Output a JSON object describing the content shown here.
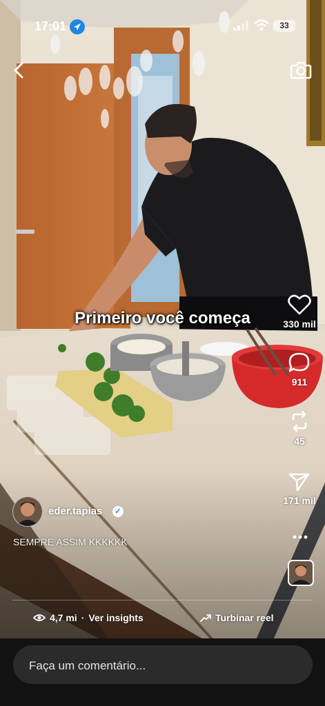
{
  "status_bar": {
    "time": "17:01",
    "battery": "33"
  },
  "reel": {
    "overlay_text": "Primeiro você começa",
    "username": "eder.tapias",
    "caption": "SEMPRE ASSIM KKKKKK",
    "views": "4,7 mi",
    "insights_label": "Ver insights",
    "boost_label": "Turbinar reel"
  },
  "actions": {
    "likes": "330 mil",
    "comments": "911",
    "reposts": "45",
    "shares": "171 mil"
  },
  "comment_input": {
    "placeholder": "Faça um comentário..."
  },
  "icons": [
    "back-arrow-icon",
    "camera-icon",
    "heart-icon",
    "comment-icon",
    "repost-icon",
    "send-icon",
    "more-icon",
    "verified-icon",
    "eye-icon",
    "trend-arrow-icon",
    "location-arrow-icon",
    "signal-icon",
    "wifi-icon",
    "battery-icon"
  ],
  "colors": {
    "accent_blue": "#1e88e5",
    "verified_blue": "#2a80f5",
    "bar_bg": "#121212",
    "input_bg": "#2b2b2b"
  }
}
